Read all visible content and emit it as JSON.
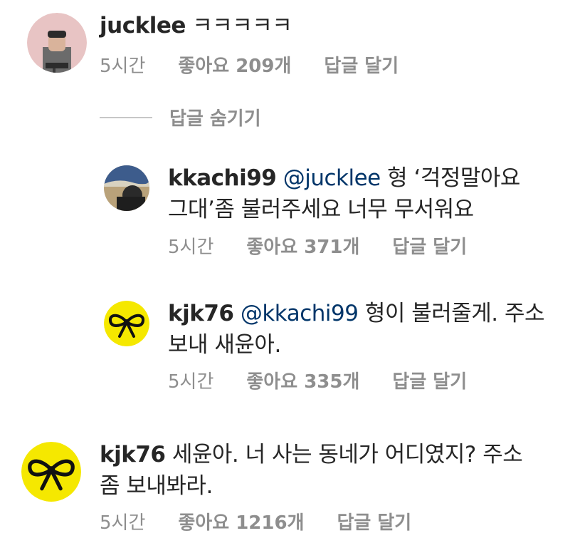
{
  "comments": [
    {
      "username": "jucklee",
      "body": " ㅋㅋㅋㅋㅋ",
      "time": "5시간",
      "likes": "좋아요 209개",
      "reply_label": "답글 달기"
    }
  ],
  "hide_replies_label": "답글 숨기기",
  "replies": [
    {
      "username": "kkachi99",
      "mention": "@jucklee",
      "body_line1": " 형 ‘걱정말아요",
      "body_line2": "그대’좀 불러주세요 너무 무서워요",
      "time": "5시간",
      "likes": "좋아요 371개",
      "reply_label": "답글 달기"
    },
    {
      "username": "kjk76",
      "mention": "@kkachi99",
      "body_line1": " 형이 불러줄게. 주소",
      "body_line2": "보내 새윤아.",
      "time": "5시간",
      "likes": "좋아요 335개",
      "reply_label": "답글 달기"
    }
  ],
  "comment2": {
    "username": "kjk76",
    "body_line1": " 세윤아. 너 사는 동네가 어디였지? 주소",
    "body_line2": "좀 보내봐라.",
    "time": "5시간",
    "likes": "좋아요 1216개",
    "reply_label": "답글 달기"
  },
  "colors": {
    "text": "#262626",
    "meta": "#8e8e8e",
    "mention": "#003569",
    "ribbon_bg": "#f5e800"
  }
}
